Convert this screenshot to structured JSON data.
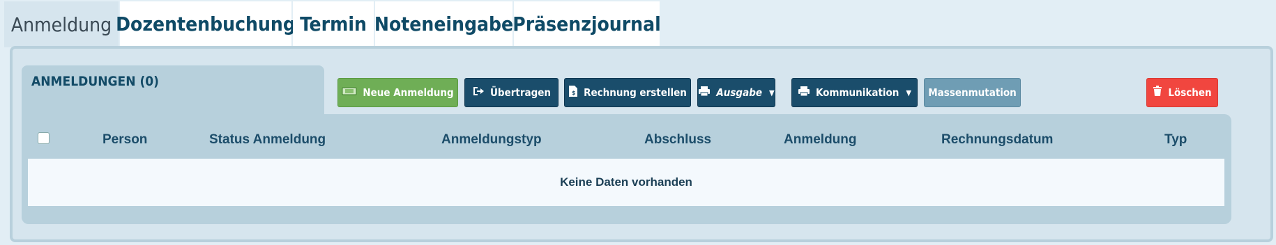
{
  "tabs": [
    {
      "label": "Anmeldung",
      "active": true
    },
    {
      "label": "Dozentenbuchung",
      "active": false
    },
    {
      "label": "Termin",
      "active": false
    },
    {
      "label": "Noteneingabe",
      "active": false
    },
    {
      "label": "Präsenzjournal",
      "active": false
    }
  ],
  "section": {
    "title": "ANMELDUNGEN (0)"
  },
  "toolbar": {
    "new": {
      "label": "Neue Anmeldung",
      "icon": "ticket-icon"
    },
    "transfer": {
      "label": "Übertragen",
      "icon": "sign-out-icon"
    },
    "invoice": {
      "label": "Rechnung erstellen",
      "icon": "invoice-icon"
    },
    "output": {
      "label": "Ausgabe",
      "icon": "printer-icon"
    },
    "communication": {
      "label": "Kommunikation",
      "icon": "printer-icon"
    },
    "mass": {
      "label": "Massenmutation"
    },
    "delete": {
      "label": "Löschen",
      "icon": "trash-icon"
    }
  },
  "grid": {
    "columns": [
      "Person",
      "Status Anmeldung",
      "Anmeldungstyp",
      "Abschluss",
      "Anmeldung",
      "Rechnungsdatum",
      "Typ"
    ],
    "empty_text": "Keine Daten vorhanden"
  },
  "colors": {
    "primary": "#1a4d6b",
    "success": "#6fae56",
    "danger": "#f1463f",
    "muted": "#6f9db4",
    "panel": "#d6e5ee"
  }
}
